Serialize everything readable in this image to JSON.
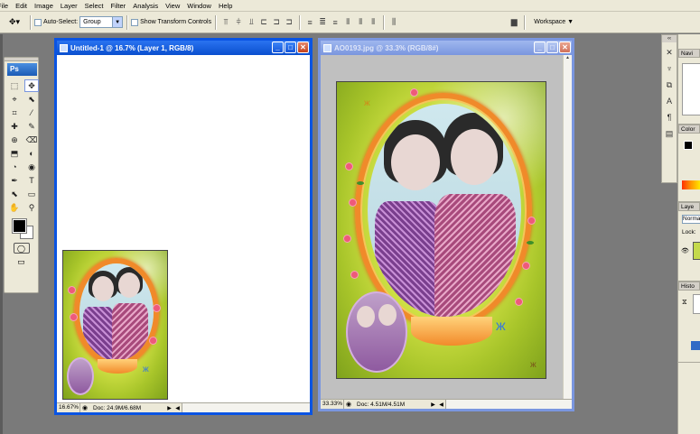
{
  "menu": [
    "File",
    "Edit",
    "Image",
    "Layer",
    "Select",
    "Filter",
    "Analysis",
    "View",
    "Window",
    "Help"
  ],
  "options": {
    "auto_select_label": "Auto-Select:",
    "auto_select_value": "Group",
    "show_transform_label": "Show Transform Controls",
    "workspace_label": "Workspace ▼"
  },
  "toolbox": {
    "logo": "Ps",
    "tools": [
      "⬚",
      "✥",
      "⌖",
      "⬉",
      "⌗",
      "⁄",
      "✚",
      "✎",
      "⊕",
      "⌫",
      "⬒",
      "◐",
      "◔",
      "◉",
      "✒",
      "T",
      "⬉",
      "▭",
      "✋",
      "⚲"
    ]
  },
  "doc1": {
    "title": "Untitled-1 @ 16.7% (Layer 1, RGB/8)",
    "zoom": "16.67%",
    "doc_size": "Doc: 24.9M/6.68M"
  },
  "doc2": {
    "title": "AO0193.jpg @ 33.3% (RGB/8#)",
    "zoom": "33.33%",
    "doc_size": "Doc: 4.51M/4.51M"
  },
  "panels": {
    "navigator_tab": "Navi",
    "color_tab": "Color",
    "layers_tab": "Laye",
    "layers_mode": "Norma",
    "lock_label": "Lock:",
    "history_tab": "Histo"
  },
  "colors": {
    "accent": "#0a54e3",
    "chrome": "#ece9d8",
    "workspace_bg": "#7a7a7a"
  }
}
